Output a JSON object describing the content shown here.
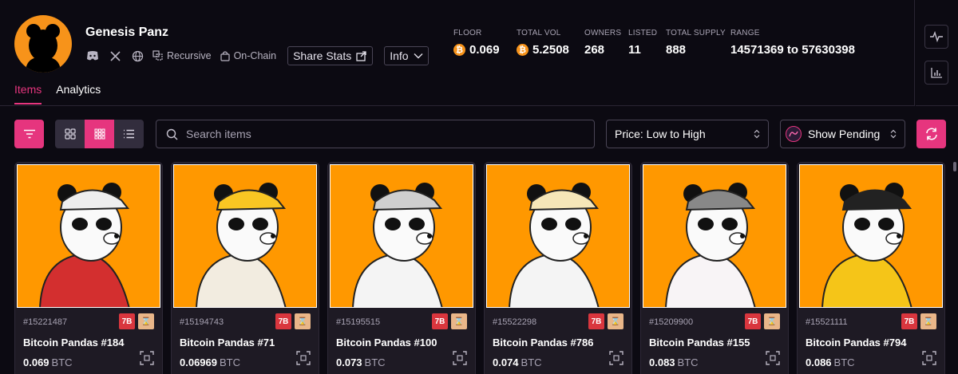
{
  "collection": {
    "name": "Genesis Panz",
    "tags": [
      {
        "label": "Recursive",
        "icon": "recursive-icon"
      },
      {
        "label": "On-Chain",
        "icon": "on-chain-icon"
      }
    ],
    "share_label": "Share Stats",
    "info_label": "Info"
  },
  "stats": {
    "floor": {
      "label": "FLOOR",
      "value": "0.069"
    },
    "total_vol": {
      "label": "TOTAL VOL",
      "value": "5.2508"
    },
    "owners": {
      "label": "OWNERS",
      "value": "268"
    },
    "listed": {
      "label": "LISTED",
      "value": "11"
    },
    "total_supply": {
      "label": "TOTAL SUPPLY",
      "value": "888"
    },
    "range": {
      "label": "RANGE",
      "value": "14571369 to 57630398"
    }
  },
  "tabs": [
    {
      "label": "Items",
      "active": true
    },
    {
      "label": "Analytics",
      "active": false
    }
  ],
  "toolbar": {
    "search_placeholder": "Search items",
    "sort_label": "Price: Low to High",
    "pending_label": "Show Pending"
  },
  "colors": {
    "accent": "#e6357e",
    "background": "#0c0a12",
    "card_bg": "#1e1a24",
    "artwork_bg": "#ff9800",
    "btc": "#f7931a"
  },
  "items": [
    {
      "id": "#15221487",
      "name": "Bitcoin Pandas #184",
      "price": "0.069",
      "unit": "BTC",
      "outfit": "#d32f2f",
      "hat": "#eeeeee"
    },
    {
      "id": "#15194743",
      "name": "Bitcoin Pandas #71",
      "price": "0.06969",
      "unit": "BTC",
      "outfit": "#f2ece0",
      "hat": "#f9c623"
    },
    {
      "id": "#15195515",
      "name": "Bitcoin Pandas #100",
      "price": "0.073",
      "unit": "BTC",
      "outfit": "#f4f4f4",
      "hat": "#cfcfcf"
    },
    {
      "id": "#15522298",
      "name": "Bitcoin Pandas #786",
      "price": "0.074",
      "unit": "BTC",
      "outfit": "#f4f4f4",
      "hat": "#f5e6b8"
    },
    {
      "id": "#15209900",
      "name": "Bitcoin Pandas #155",
      "price": "0.083",
      "unit": "BTC",
      "outfit": "#f8f4f6",
      "hat": "#888888"
    },
    {
      "id": "#15521111",
      "name": "Bitcoin Pandas #794",
      "price": "0.086",
      "unit": "BTC",
      "outfit": "#f5c518",
      "hat": "#222222"
    }
  ],
  "badge_labels": {
    "recursive": "7B",
    "pending": "⌛"
  }
}
